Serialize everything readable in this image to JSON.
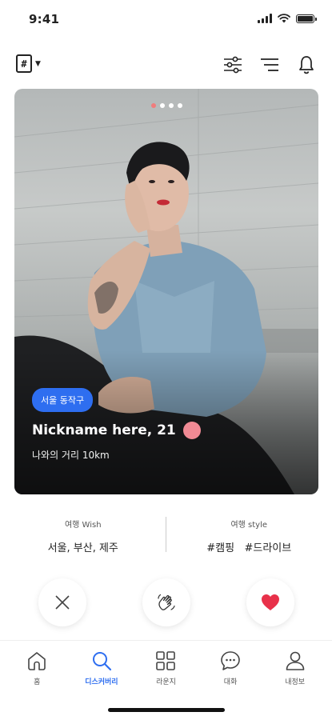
{
  "status_bar": {
    "time": "9:41"
  },
  "toolbar": {
    "hash_label": "#"
  },
  "card": {
    "location": "서울 동작구",
    "name": "Nickname here, 21",
    "distance": "나와의 거리 10km",
    "dots_total": 4,
    "dots_active_index": 0
  },
  "info": {
    "wish_label": "여행 Wish",
    "wish_value": "서울, 부산, 제주",
    "style_label": "여행 style",
    "style_value": "#캠핑   #드라이브"
  },
  "tabs": [
    {
      "label": "홈",
      "icon": "home-icon"
    },
    {
      "label": "디스커버리",
      "icon": "search-icon",
      "active": true
    },
    {
      "label": "라운지",
      "icon": "grid-icon"
    },
    {
      "label": "대화",
      "icon": "chat-icon"
    },
    {
      "label": "내정보",
      "icon": "user-icon"
    }
  ],
  "colors": {
    "accent": "#2e6ef0",
    "like": "#e8314a",
    "online": "#f08a94",
    "dot_active": "#f07c7c"
  }
}
